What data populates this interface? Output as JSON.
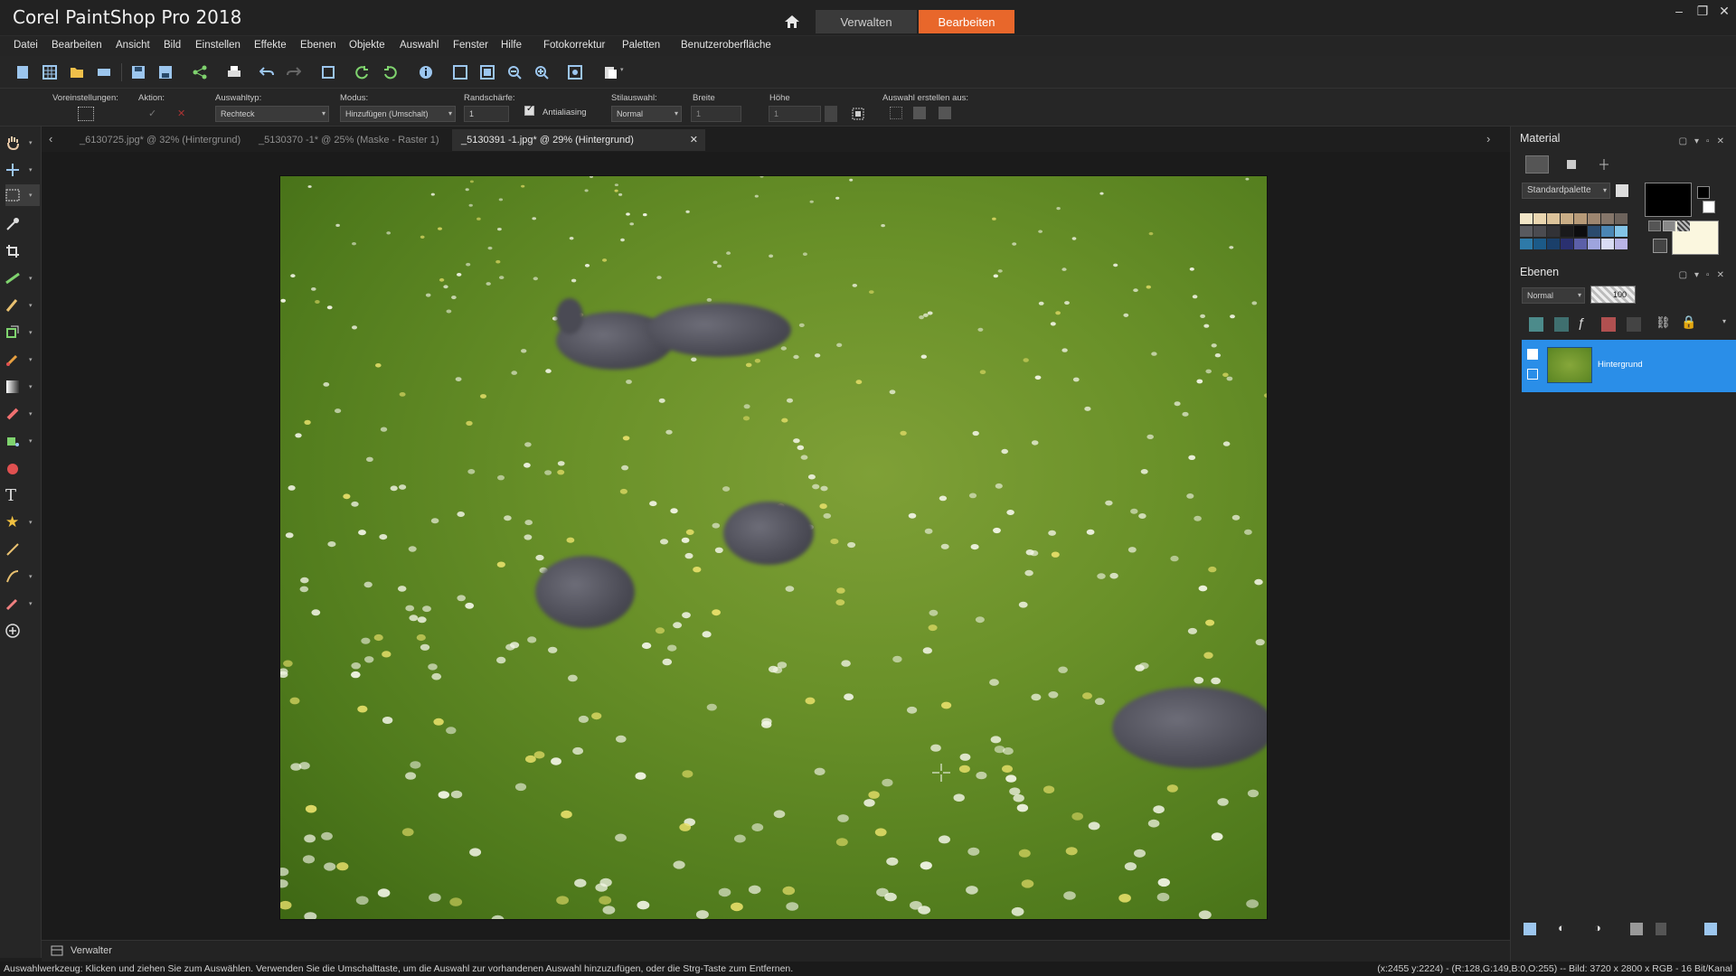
{
  "app": {
    "title": "Corel PaintShop Pro 2018",
    "mode_tabs": [
      "Verwalten",
      "Bearbeiten"
    ],
    "active_mode": "Bearbeiten"
  },
  "menu": [
    "Datei",
    "Bearbeiten",
    "Ansicht",
    "Bild",
    "Einstellen",
    "Effekte",
    "Ebenen",
    "Objekte",
    "Auswahl",
    "Fenster",
    "Hilfe",
    "Fotokorrektur",
    "Paletten",
    "Benutzeroberfläche"
  ],
  "options_bar": {
    "presets_label": "Voreinstellungen:",
    "action_label": "Aktion:",
    "selection_type_label": "Auswahltyp:",
    "selection_type_value": "Rechteck",
    "mode_label": "Modus:",
    "mode_value": "Hinzufügen (Umschalt)",
    "feather_label": "Randschärfe:",
    "feather_value": "1",
    "antialias_label": "Antialiasing",
    "style_label": "Stilauswahl:",
    "style_value": "Normal",
    "width_label": "Breite",
    "width_value": "1",
    "height_label": "Höhe",
    "height_value": "1",
    "create_from_label": "Auswahl erstellen aus:"
  },
  "doc_tabs": [
    {
      "label": "_6130725.jpg* @  32% (Hintergrund)",
      "active": false
    },
    {
      "label": "_5130370 -1* @  25% (Maske - Raster 1)",
      "active": false
    },
    {
      "label": "_5130391 -1.jpg* @  29% (Hintergrund)",
      "active": true
    }
  ],
  "material_panel": {
    "title": "Material",
    "palette_select": "Standardpalette",
    "swatches": [
      "#f2e6c8",
      "#ead6b0",
      "#dcc39b",
      "#c9ad86",
      "#b79a78",
      "#9d8670",
      "#85766a",
      "#6d635c",
      "#595a5f",
      "#4b4b50",
      "#323236",
      "#1a1a1c",
      "#0d0d0f",
      "#2b4b6e",
      "#4b86b4",
      "#83c4e8",
      "#2e7aa8",
      "#1c5a88",
      "#1a3f6a",
      "#2a3070",
      "#5b5fa8",
      "#9ea4dd",
      "#d9dcf4",
      "#b9b4e6"
    ]
  },
  "layers_panel": {
    "title": "Ebenen",
    "blend_mode": "Normal",
    "opacity": "100",
    "layer_name": "Hintergrund"
  },
  "bottom": {
    "manager_label": "Verwalter"
  },
  "status": {
    "left": "Auswahlwerkzeug: Klicken und ziehen Sie zum Auswählen. Verwenden Sie die Umschalttaste, um die Auswahl zur vorhandenen Auswahl hinzuzufügen, oder die Strg-Taste zum Entfernen.",
    "right": "(x:2455 y:2224) - (R:128,G:149,B:0,O:255) -- Bild:  3720 x 2800 x RGB - 16 Bit/Kanal"
  },
  "colors": {
    "accent": "#e8672b",
    "selection": "#2a8ee8",
    "background": "#1e1e1e"
  }
}
